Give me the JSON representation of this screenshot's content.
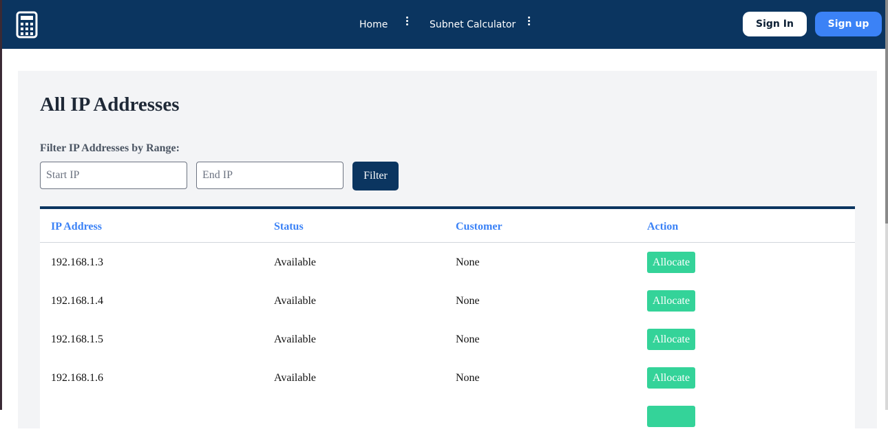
{
  "nav": {
    "links": [
      {
        "label": "Home"
      },
      {
        "label": "Subnet Calculator"
      }
    ],
    "sign_in": "Sign In",
    "sign_up": "Sign up",
    "logo_icon": "calculator-icon"
  },
  "page": {
    "title": "All IP Addresses",
    "filter_label": "Filter IP Addresses by Range:",
    "start_placeholder": "Start IP",
    "end_placeholder": "End IP",
    "filter_button": "Filter"
  },
  "table": {
    "headers": [
      "IP Address",
      "Status",
      "Customer",
      "Action"
    ],
    "rows": [
      {
        "ip": "192.168.1.3",
        "status": "Available",
        "customer": "None",
        "action": "Allocate"
      },
      {
        "ip": "192.168.1.4",
        "status": "Available",
        "customer": "None",
        "action": "Allocate"
      },
      {
        "ip": "192.168.1.5",
        "status": "Available",
        "customer": "None",
        "action": "Allocate"
      },
      {
        "ip": "192.168.1.6",
        "status": "Available",
        "customer": "None",
        "action": "Allocate"
      },
      {
        "ip": "",
        "status": "",
        "customer": "",
        "action": ""
      }
    ]
  },
  "colors": {
    "navbar": "#0b3560",
    "header_text": "#3b82f6",
    "allocate": "#34d399",
    "sign_up": "#3b82f6"
  }
}
